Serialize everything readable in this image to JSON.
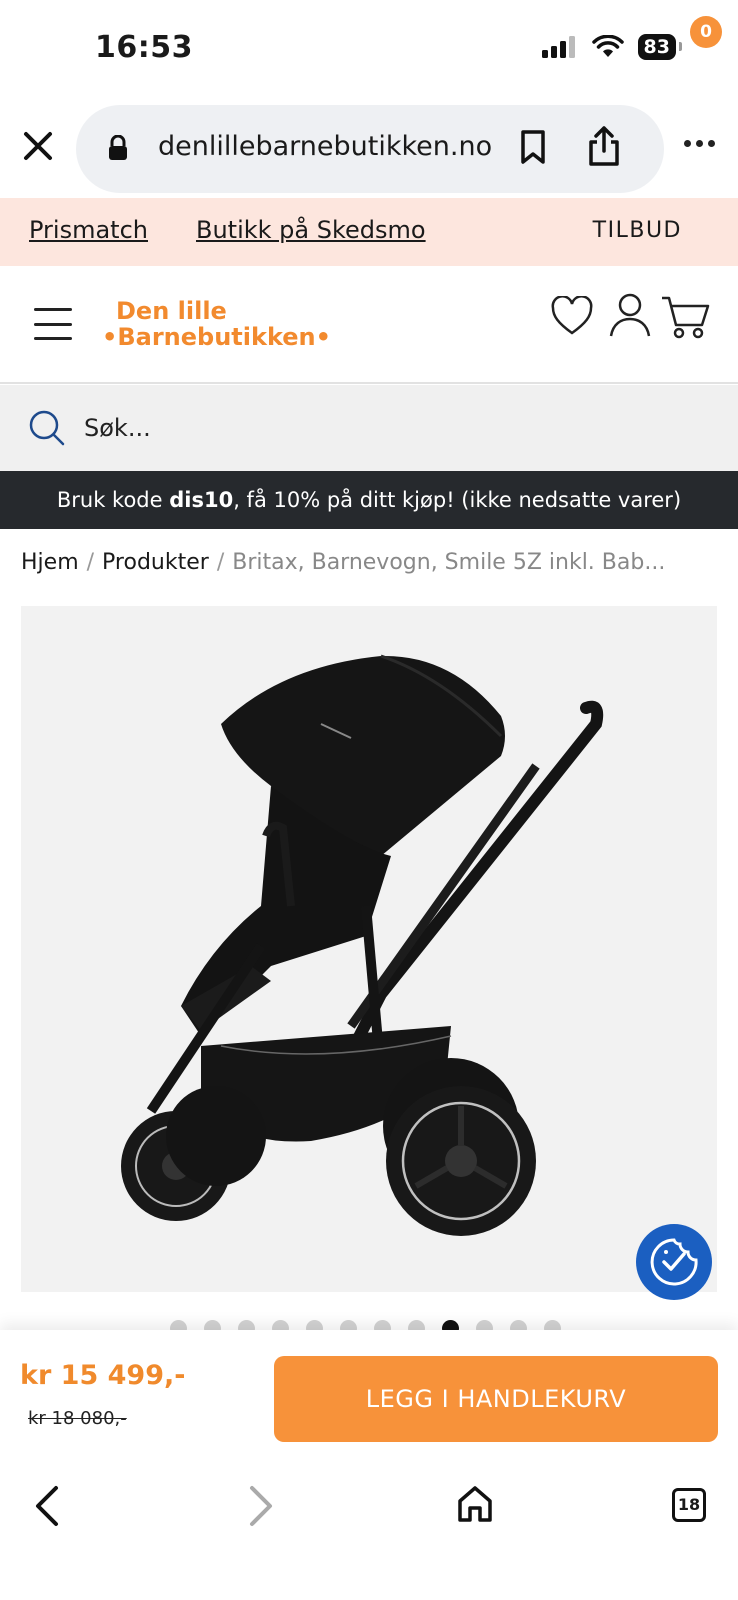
{
  "status_bar": {
    "time": "16:53",
    "battery": "83"
  },
  "browser": {
    "url": "denlillebarnebutikken.no",
    "tab_count": "18"
  },
  "promo_strip": {
    "links": [
      "Prismatch",
      "Butikk på Skedsmo"
    ],
    "tilbud": "TILBUD"
  },
  "header": {
    "logo_line1": "Den lille",
    "logo_line2": "•Barnebutikken•",
    "cart_count": "0"
  },
  "search": {
    "placeholder": "Søk..."
  },
  "code_banner": {
    "prefix": "Bruk kode ",
    "code": "dis10",
    "suffix": ", få 10% på ditt kjøp! (ikke nedsatte varer)"
  },
  "breadcrumb": {
    "home": "Hjem",
    "products": "Produkter",
    "current": "Britax, Barnevogn, Smile 5Z inkl. Bab..."
  },
  "carousel": {
    "total": 12,
    "active_index": 8
  },
  "product": {
    "price": "kr 15 499,-",
    "old_price": "kr 18 080,-",
    "add_to_cart": "LEGG I HANDLEKURV"
  },
  "colors": {
    "accent": "#f7923a",
    "promo_bg": "#fde6de",
    "banner_bg": "#26292d",
    "cookie": "#1b5fc1"
  }
}
